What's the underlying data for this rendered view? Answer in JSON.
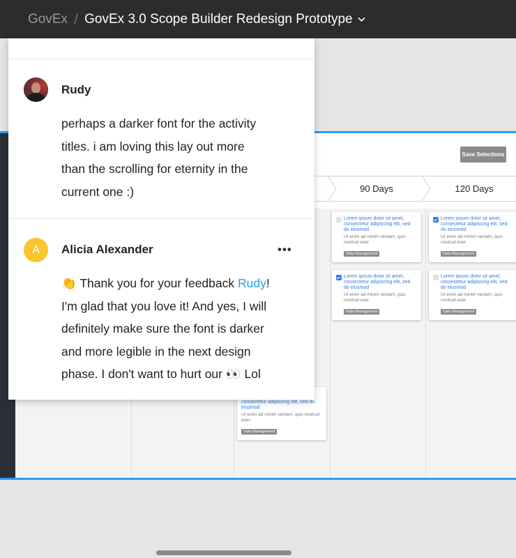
{
  "breadcrumb": {
    "team": "GovEx",
    "separator": "/",
    "project": "GovEx 3.0 Scope Builder Redesign Prototype"
  },
  "prototype": {
    "save_button": "Save Selections",
    "stages": [
      "90 Days",
      "120 Days"
    ],
    "card_title": "Lorem ipsum dolor sit amet, consectetur adipiscing elit, sed do eiusmod",
    "card_partial_title": "consectetur adipiscing elit, sed do eiusmod",
    "card_desc": "Ut enim ad minim veniam, quis nostrud exer",
    "card_tag": "Data Management"
  },
  "comments": [
    {
      "author": "Rudy",
      "text": "perhaps a darker font for the activity titles. i am loving this lay out more than the scrolling for eternity in the current one :)"
    },
    {
      "author": "Alicia Alexander",
      "avatar_letter": "A",
      "emoji_start": "👏",
      "text_line_1": " Thank you for your feedback",
      "mention": "Rudy",
      "text_after_mention": "! I'm glad that you love it! And yes, I will definitely make sure the font is darker and more legible in the next design phase. I don't want to hurt our ",
      "emoji_end": "👀",
      "text_end": " Lol",
      "more_label": "•••"
    }
  ],
  "colors": {
    "topbar": "#2c2c2c",
    "accent": "#2d9bf0",
    "card_title": "#2d7be6",
    "avatar_yellow": "#f9c62b"
  }
}
